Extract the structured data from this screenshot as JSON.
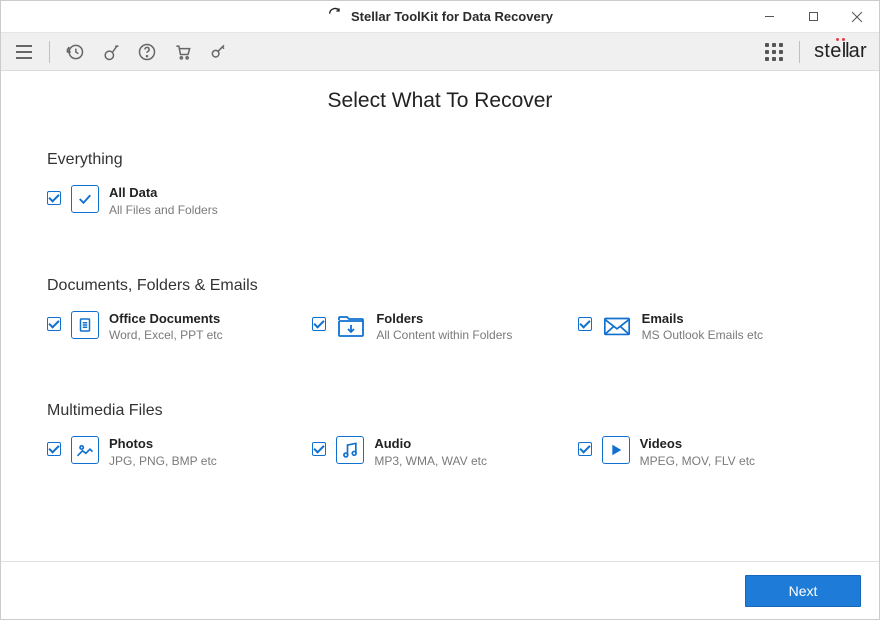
{
  "window": {
    "title": "Stellar ToolKit for Data Recovery"
  },
  "brand": {
    "text": "stellar"
  },
  "page_title": "Select What To Recover",
  "sections": {
    "everything": {
      "heading": "Everything",
      "all_data": {
        "title": "All Data",
        "sub": "All Files and Folders",
        "checked": true
      }
    },
    "documents": {
      "heading": "Documents, Folders & Emails",
      "office": {
        "title": "Office Documents",
        "sub": "Word, Excel, PPT etc",
        "checked": true
      },
      "folders": {
        "title": "Folders",
        "sub": "All Content within Folders",
        "checked": true
      },
      "emails": {
        "title": "Emails",
        "sub": "MS Outlook Emails etc",
        "checked": true
      }
    },
    "multimedia": {
      "heading": "Multimedia Files",
      "photos": {
        "title": "Photos",
        "sub": "JPG, PNG, BMP etc",
        "checked": true
      },
      "audio": {
        "title": "Audio",
        "sub": "MP3, WMA, WAV etc",
        "checked": true
      },
      "videos": {
        "title": "Videos",
        "sub": "MPEG, MOV, FLV etc",
        "checked": true
      }
    }
  },
  "footer": {
    "next_label": "Next"
  }
}
